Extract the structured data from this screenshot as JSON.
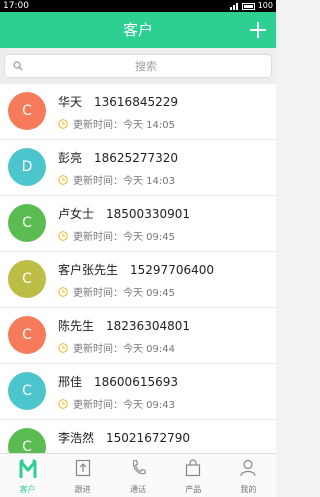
{
  "status": {
    "time": "17:00",
    "battery": "100"
  },
  "header": {
    "title": "客户"
  },
  "search": {
    "placeholder": "搜索"
  },
  "customers": [
    {
      "initial": "C",
      "name": "华天",
      "phone": "13616845229",
      "updated": "更新时间：今天 14:05",
      "color": "#f57b5b"
    },
    {
      "initial": "D",
      "name": "彭亮",
      "phone": "18625277320",
      "updated": "更新时间：今天 14:03",
      "color": "#4cc6cc"
    },
    {
      "initial": "C",
      "name": "卢女士",
      "phone": "18500330901",
      "updated": "更新时间：今天 09:45",
      "color": "#5bbc52"
    },
    {
      "initial": "C",
      "name": "客户张先生",
      "phone": "15297706400",
      "updated": "更新时间：今天 09:45",
      "color": "#bcbd44"
    },
    {
      "initial": "C",
      "name": "陈先生",
      "phone": "18236304801",
      "updated": "更新时间：今天 09:44",
      "color": "#f57b5b"
    },
    {
      "initial": "C",
      "name": "邢佳",
      "phone": "18600615693",
      "updated": "更新时间：今天 09:43",
      "color": "#4cc6cc"
    },
    {
      "initial": "C",
      "name": "李浩然",
      "phone": "15021672790",
      "updated": "更新时间：今天 09:43",
      "color": "#5bbc52"
    }
  ],
  "tabs": [
    {
      "label": "客户",
      "icon": "customers-logo-icon",
      "active": true
    },
    {
      "label": "跟进",
      "icon": "follow-up-icon",
      "active": false
    },
    {
      "label": "通话",
      "icon": "phone-icon",
      "active": false
    },
    {
      "label": "产品",
      "icon": "shopping-bag-icon",
      "active": false
    },
    {
      "label": "我的",
      "icon": "user-icon",
      "active": false
    }
  ],
  "colors": {
    "accent": "#2ed091",
    "clock": "#f0b429"
  }
}
